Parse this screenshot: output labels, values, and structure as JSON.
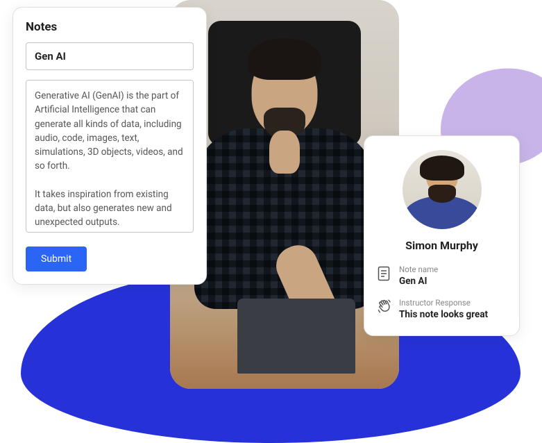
{
  "notes": {
    "panel_title": "Notes",
    "name_value": "Gen AI",
    "body_value": "Generative AI (GenAI) is the part of Artificial Intelligence that can generate all kinds of data, including audio, code, images, text, simulations, 3D objects, videos, and so forth.\n\nIt takes inspiration from existing data, but also generates new and unexpected outputs.",
    "submit_label": "Submit"
  },
  "detail": {
    "user_name": "Simon Murphy",
    "note_name_label": "Note name",
    "note_name_value": "Gen AI",
    "instructor_label": "Instructor Response",
    "instructor_value": "This note looks great"
  },
  "colors": {
    "accent": "#2b65f6",
    "blob_blue": "#2632d8",
    "blob_purple": "#c8b4e8"
  }
}
